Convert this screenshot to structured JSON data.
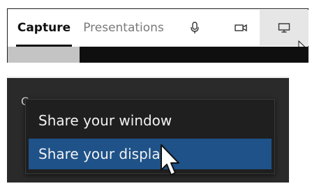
{
  "tabs": {
    "capture_label": "Capture",
    "presentations_label": "Presentations",
    "mic_icon": "microphone-icon",
    "camera_icon": "video-camera-icon",
    "screen_icon": "monitor-icon",
    "active_tab": "Capture",
    "hovered_tab": "screen-share"
  },
  "progress": {
    "fill_fraction": 0.24,
    "fill_color": "#c4c4c4",
    "track_color": "#0f0f0f"
  },
  "share_menu": {
    "partial_label": "C",
    "items": [
      {
        "label": "Share your window"
      },
      {
        "label": "Share your display"
      }
    ],
    "selected_index": 1,
    "highlight_color": "#1e5288",
    "background_color": "#1f1f1f"
  }
}
